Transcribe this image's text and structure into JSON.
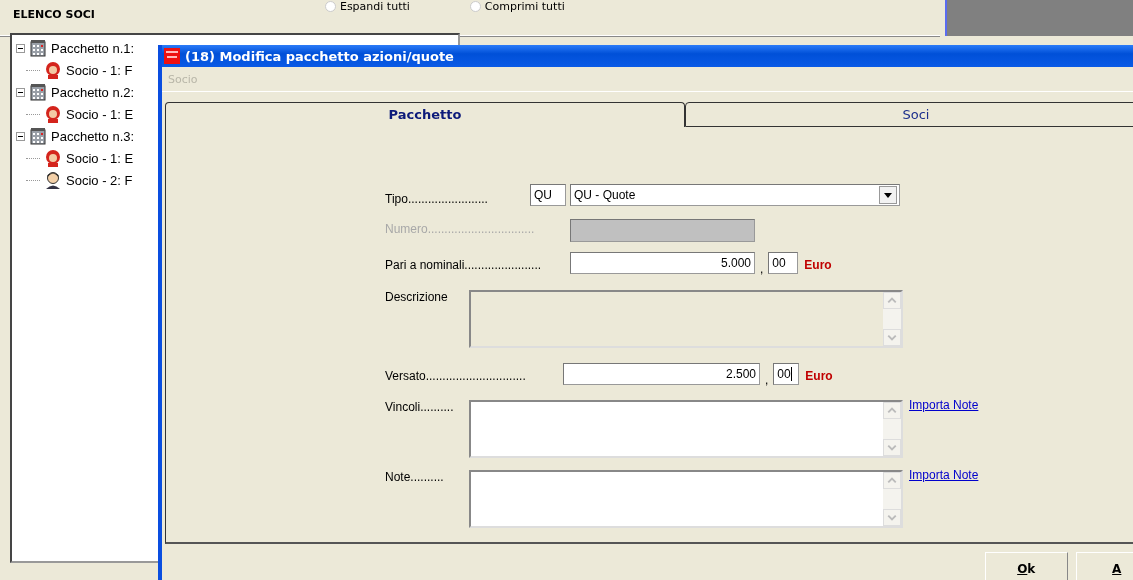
{
  "header": {
    "title": "ELENCO SOCI",
    "options": [
      {
        "label": "Espandi tutti",
        "selected": false
      },
      {
        "label": "Comprimi tutti",
        "selected": false
      }
    ]
  },
  "tree": [
    {
      "label": "Pacchetto n.1:",
      "expanded": true,
      "children": [
        {
          "label": "Socio - 1: F",
          "kind": "female"
        }
      ]
    },
    {
      "label": "Pacchetto n.2:",
      "expanded": true,
      "children": [
        {
          "label": "Socio - 1: E",
          "kind": "female"
        }
      ]
    },
    {
      "label": "Pacchetto n.3:",
      "expanded": true,
      "children": [
        {
          "label": "Socio - 1: E",
          "kind": "female"
        },
        {
          "label": "Socio - 2: F",
          "kind": "male"
        }
      ]
    }
  ],
  "dialog": {
    "title": "(18) Modifica pacchetto azioni/quote",
    "menu": [
      {
        "label": "Socio",
        "disabled": true
      }
    ],
    "tabs": [
      {
        "label": "Pacchetto",
        "selected": true
      },
      {
        "label": "Soci",
        "selected": false
      }
    ],
    "form": {
      "tipo": {
        "label": "Tipo........................",
        "code": "QU",
        "value": "QU - Quote"
      },
      "numero": {
        "label": "Numero................................",
        "disabled": true
      },
      "pari": {
        "label": "Pari a nominali.......................",
        "amount": "5.000",
        "separator": ",",
        "cents": "00",
        "currency": "Euro"
      },
      "descrizione": {
        "label": "Descrizione",
        "disabled": true
      },
      "versato": {
        "label": "Versato..............................",
        "amount": "2.500",
        "separator": ",",
        "cents": "00",
        "currency": "Euro"
      },
      "vincoli": {
        "label": "Vincoli..........",
        "link": "Importa Note"
      },
      "note": {
        "label": "Note..........",
        "link": "Importa Note"
      }
    },
    "buttons": [
      {
        "label": "Ok"
      },
      {
        "label": "A"
      }
    ]
  }
}
